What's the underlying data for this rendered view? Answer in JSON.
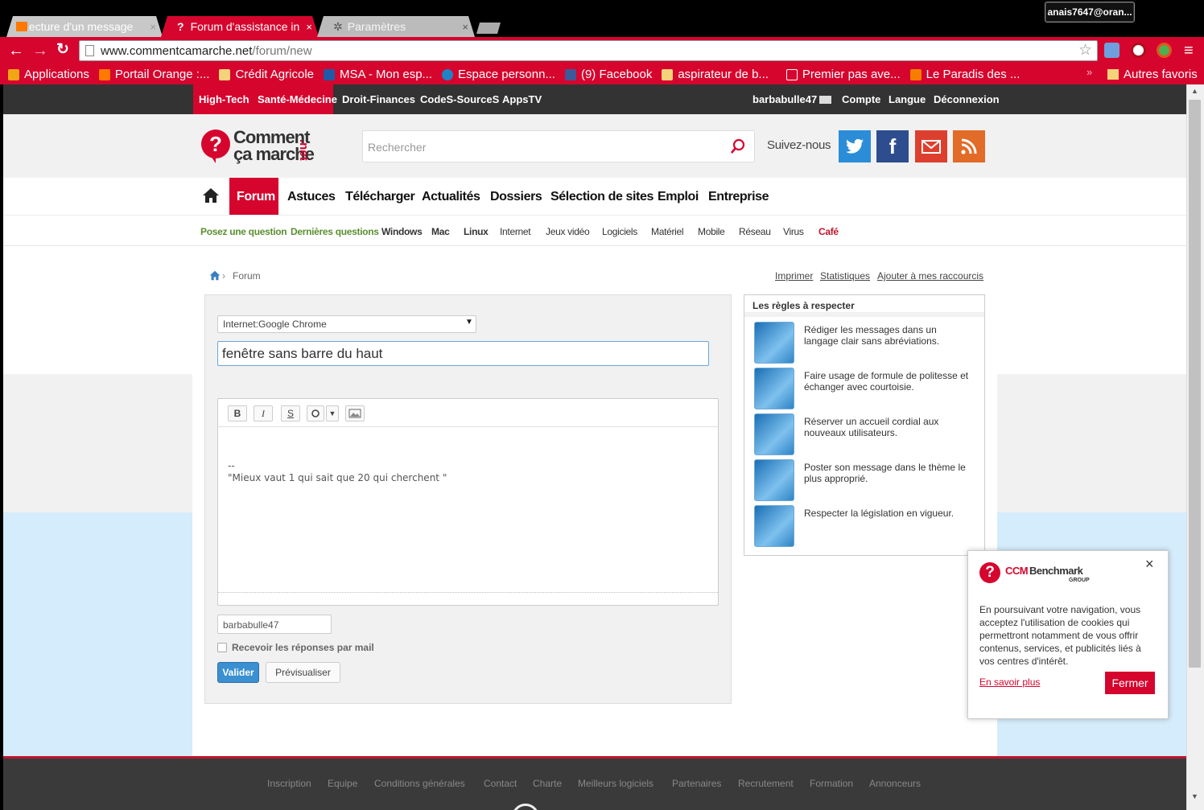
{
  "browser": {
    "tabs": [
      {
        "title": "Lecture d'un message",
        "close": "×"
      },
      {
        "title": "Forum d'assistance in",
        "close": "×"
      },
      {
        "title": "Paramètres",
        "close": "×"
      }
    ],
    "profile_name": "anais7647@oran...",
    "url_host": "www.commentcamarche.net",
    "url_path": "/forum/new",
    "bookmarks": [
      {
        "label": "Applications",
        "icon": "apps-grid-icon",
        "color": "#f2a516"
      },
      {
        "label": "Portail Orange :...",
        "icon": "orange-icon",
        "color": "#ff7900"
      },
      {
        "label": "Crédit Agricole",
        "icon": "folder-icon",
        "color": "#f5d37a"
      },
      {
        "label": "MSA - Mon esp...",
        "icon": "msa-icon",
        "color": "#1f5aa6"
      },
      {
        "label": "Espace personn...",
        "icon": "e-icon",
        "color": "#1d84c6"
      },
      {
        "label": "(9) Facebook",
        "icon": "facebook-icon",
        "color": "#3b5998"
      },
      {
        "label": "aspirateur de b...",
        "icon": "folder-icon",
        "color": "#f5d37a"
      },
      {
        "label": "Premier pas ave...",
        "icon": "arrow-icon",
        "color": "#d6052e"
      },
      {
        "label": "Le Paradis des ...",
        "icon": "blogger-icon",
        "color": "#f57d00"
      }
    ],
    "other_bookmarks": "Autres favoris"
  },
  "topbar": {
    "left_links": [
      "High-Tech",
      "Santé-Médecine",
      "Droit-Finances",
      "CodeS-SourceS",
      "AppsTV"
    ],
    "user": "barbabulle47",
    "right_links": [
      "Compte",
      "Langue",
      "Déconnexion"
    ]
  },
  "header": {
    "logo_line1": "Comment",
    "logo_line2": "ça marche",
    "logo_net": ".net",
    "search_placeholder": "Rechercher",
    "follow_label": "Suivez-nous",
    "social": [
      {
        "name": "twitter",
        "color": "#2b8dd8"
      },
      {
        "name": "facebook",
        "color": "#2d4d8e"
      },
      {
        "name": "mail",
        "color": "#dd3f2e"
      },
      {
        "name": "rss",
        "color": "#e26b27"
      }
    ]
  },
  "nav": {
    "items": [
      "Forum",
      "Astuces",
      "Télécharger",
      "Actualités",
      "Dossiers",
      "Sélection de sites",
      "Emploi",
      "Entreprise"
    ],
    "active": "Forum",
    "accent": "#d6052e"
  },
  "subnav": {
    "items": [
      "Posez une question",
      "Dernières questions",
      "Windows",
      "Mac",
      "Linux",
      "Internet",
      "Jeux vidéo",
      "Logiciels",
      "Matériel",
      "Mobile",
      "Réseau",
      "Virus",
      "Café"
    ]
  },
  "breadcrumb": {
    "current": "Forum",
    "separator": "›"
  },
  "page_tools": [
    "Imprimer",
    "Statistiques",
    "Ajouter à mes raccourcis"
  ],
  "form": {
    "category_value": "Internet:Google Chrome",
    "title_value": "fenêtre sans barre du haut",
    "editor_buttons": [
      "B",
      "I",
      "S"
    ],
    "signature_dash": "--",
    "signature_text": "\"Mieux vaut 1 qui sait que 20 qui cherchent \"",
    "username": "barbabulle47",
    "notify_label": "Recevoir les réponses par mail",
    "submit_label": "Valider",
    "preview_label": "Prévisualiser"
  },
  "rules": {
    "title": "Les règles à respecter",
    "items": [
      "Rédiger les messages dans un langage clair sans abréviations.",
      "Faire usage de formule de politesse et échanger avec courtoisie.",
      "Réserver un accueil cordial aux nouveaux utilisateurs.",
      "Poster son message dans le thème le plus approprié.",
      "Respecter la législation en vigueur."
    ]
  },
  "cookie": {
    "brand": "CCM",
    "brand2": "Benchmark",
    "group": "GROUP",
    "text": "En poursuivant votre navigation, vous acceptez l'utilisation de cookies qui permettront notamment de vous offrir contenus, services, et publicités liés à vos centres d'intérêt.",
    "more_label": "En savoir plus",
    "close_label": "Fermer",
    "x": "×"
  },
  "footer": {
    "links": [
      "Inscription",
      "Equipe",
      "Conditions générales",
      "Contact",
      "Charte",
      "Meilleurs logiciels",
      "Partenaires",
      "Recrutement",
      "Formation",
      "Annonceurs"
    ]
  }
}
